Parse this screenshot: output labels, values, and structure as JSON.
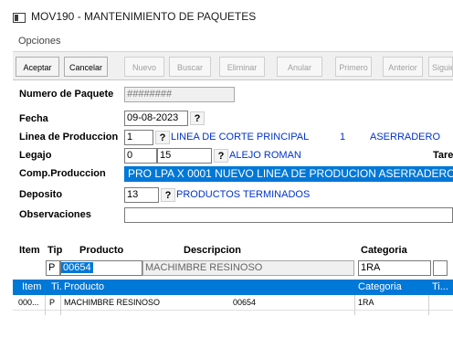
{
  "window": {
    "title": "MOV190 - MANTENIMIENTO DE PAQUETES"
  },
  "menu": {
    "opciones": "Opciones"
  },
  "toolbar": {
    "aceptar": "Aceptar",
    "cancelar": "Cancelar",
    "nuevo": "Nuevo",
    "buscar": "Buscar",
    "eliminar": "Eliminar",
    "anular": "Anular",
    "primero": "Primero",
    "anterior": "Anterior",
    "siguiente": "Siguie"
  },
  "form": {
    "numero_paquete": {
      "label": "Numero de Paquete",
      "value": "########"
    },
    "fecha": {
      "label": "Fecha",
      "value": "09-08-2023",
      "lookup": "?"
    },
    "linea": {
      "label": "Linea de Produccion",
      "value": "1",
      "lookup": "?",
      "desc": "LINEA DE CORTE PRINCIPAL",
      "num": "1",
      "extra": "ASERRADERO"
    },
    "legajo": {
      "label": "Legajo",
      "value1": "0",
      "value2": "15",
      "lookup": "?",
      "desc": "ALEJO ROMAN",
      "extra": "Tare"
    },
    "comp": {
      "label": "Comp.Produccion",
      "value": "PRO LPA X 0001 NUEVO    LINEA DE PRODUCION ASERRADERO"
    },
    "deposito": {
      "label": "Deposito",
      "value": "13",
      "lookup": "?",
      "desc": "PRODUCTOS TERMINADOS"
    },
    "observaciones": {
      "label": "Observaciones",
      "value": ""
    }
  },
  "detail": {
    "headers": {
      "item": "Item",
      "tip": "Tip",
      "producto": "Producto",
      "descripcion": "Descripcion",
      "categoria": "Categoria"
    },
    "entry": {
      "tip": "P",
      "producto": "00654",
      "descripcion": "MACHIMBRE RESINOSO",
      "categoria": "1RA"
    }
  },
  "grid": {
    "columns": {
      "item": "Item",
      "ti": "Ti.",
      "producto": "Producto",
      "categoria": "Categoria",
      "ti2": "Ti..."
    },
    "rows": [
      {
        "item": "000...",
        "ti": "P",
        "producto": "MACHIMBRE RESINOSO",
        "codigo": "00654",
        "categoria": "1RA"
      }
    ]
  }
}
